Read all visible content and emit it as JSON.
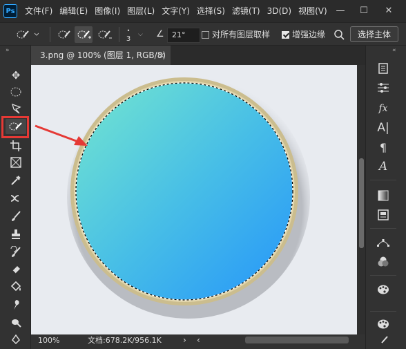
{
  "app": {
    "logo": "Ps"
  },
  "menu": [
    "文件(F)",
    "编辑(E)",
    "图像(I)",
    "图层(L)",
    "文字(Y)",
    "选择(S)",
    "滤镜(T)",
    "3D(D)",
    "视图(V)"
  ],
  "options": {
    "brush_size": "3",
    "angle": "21°",
    "sample_all_layers_label": "对所有图层取样",
    "sample_all_layers_checked": false,
    "enhance_edge_label": "增强边缘",
    "enhance_edge_checked": true,
    "select_subject_label": "选择主体"
  },
  "document_tab": {
    "title": "3.png @ 100% (图层 1, RGB/8) *",
    "close": "×"
  },
  "status": {
    "zoom": "100%",
    "doc_info": "文档:678.2K/956.1K"
  },
  "canvas": {
    "circle_gradient_start": "#6fe0d2",
    "circle_gradient_end": "#2aa0f5",
    "frame_color": "#cbbd8e",
    "background": "#e8ebf0",
    "annotation_arrow_color": "#e53935"
  },
  "icons": {
    "toolbar": [
      "move-icon",
      "elliptical-marquee-icon",
      "lasso-icon",
      "quick-selection-icon",
      "crop-icon",
      "frame-icon",
      "eyedropper-icon",
      "healing-brush-icon",
      "brush-icon",
      "clone-stamp-icon",
      "history-brush-icon",
      "eraser-icon",
      "paint-bucket-icon",
      "smudge-icon",
      "dodge-icon",
      "pen-icon"
    ],
    "right_panel": [
      "history-icon",
      "adjustments-icon",
      "fx-icon",
      "character-icon",
      "paragraph-icon",
      "glyphs-icon",
      "gradient-icon",
      "swatches-icon",
      "paths-icon",
      "channels-icon",
      "palette-icon",
      "palette-icon"
    ]
  }
}
